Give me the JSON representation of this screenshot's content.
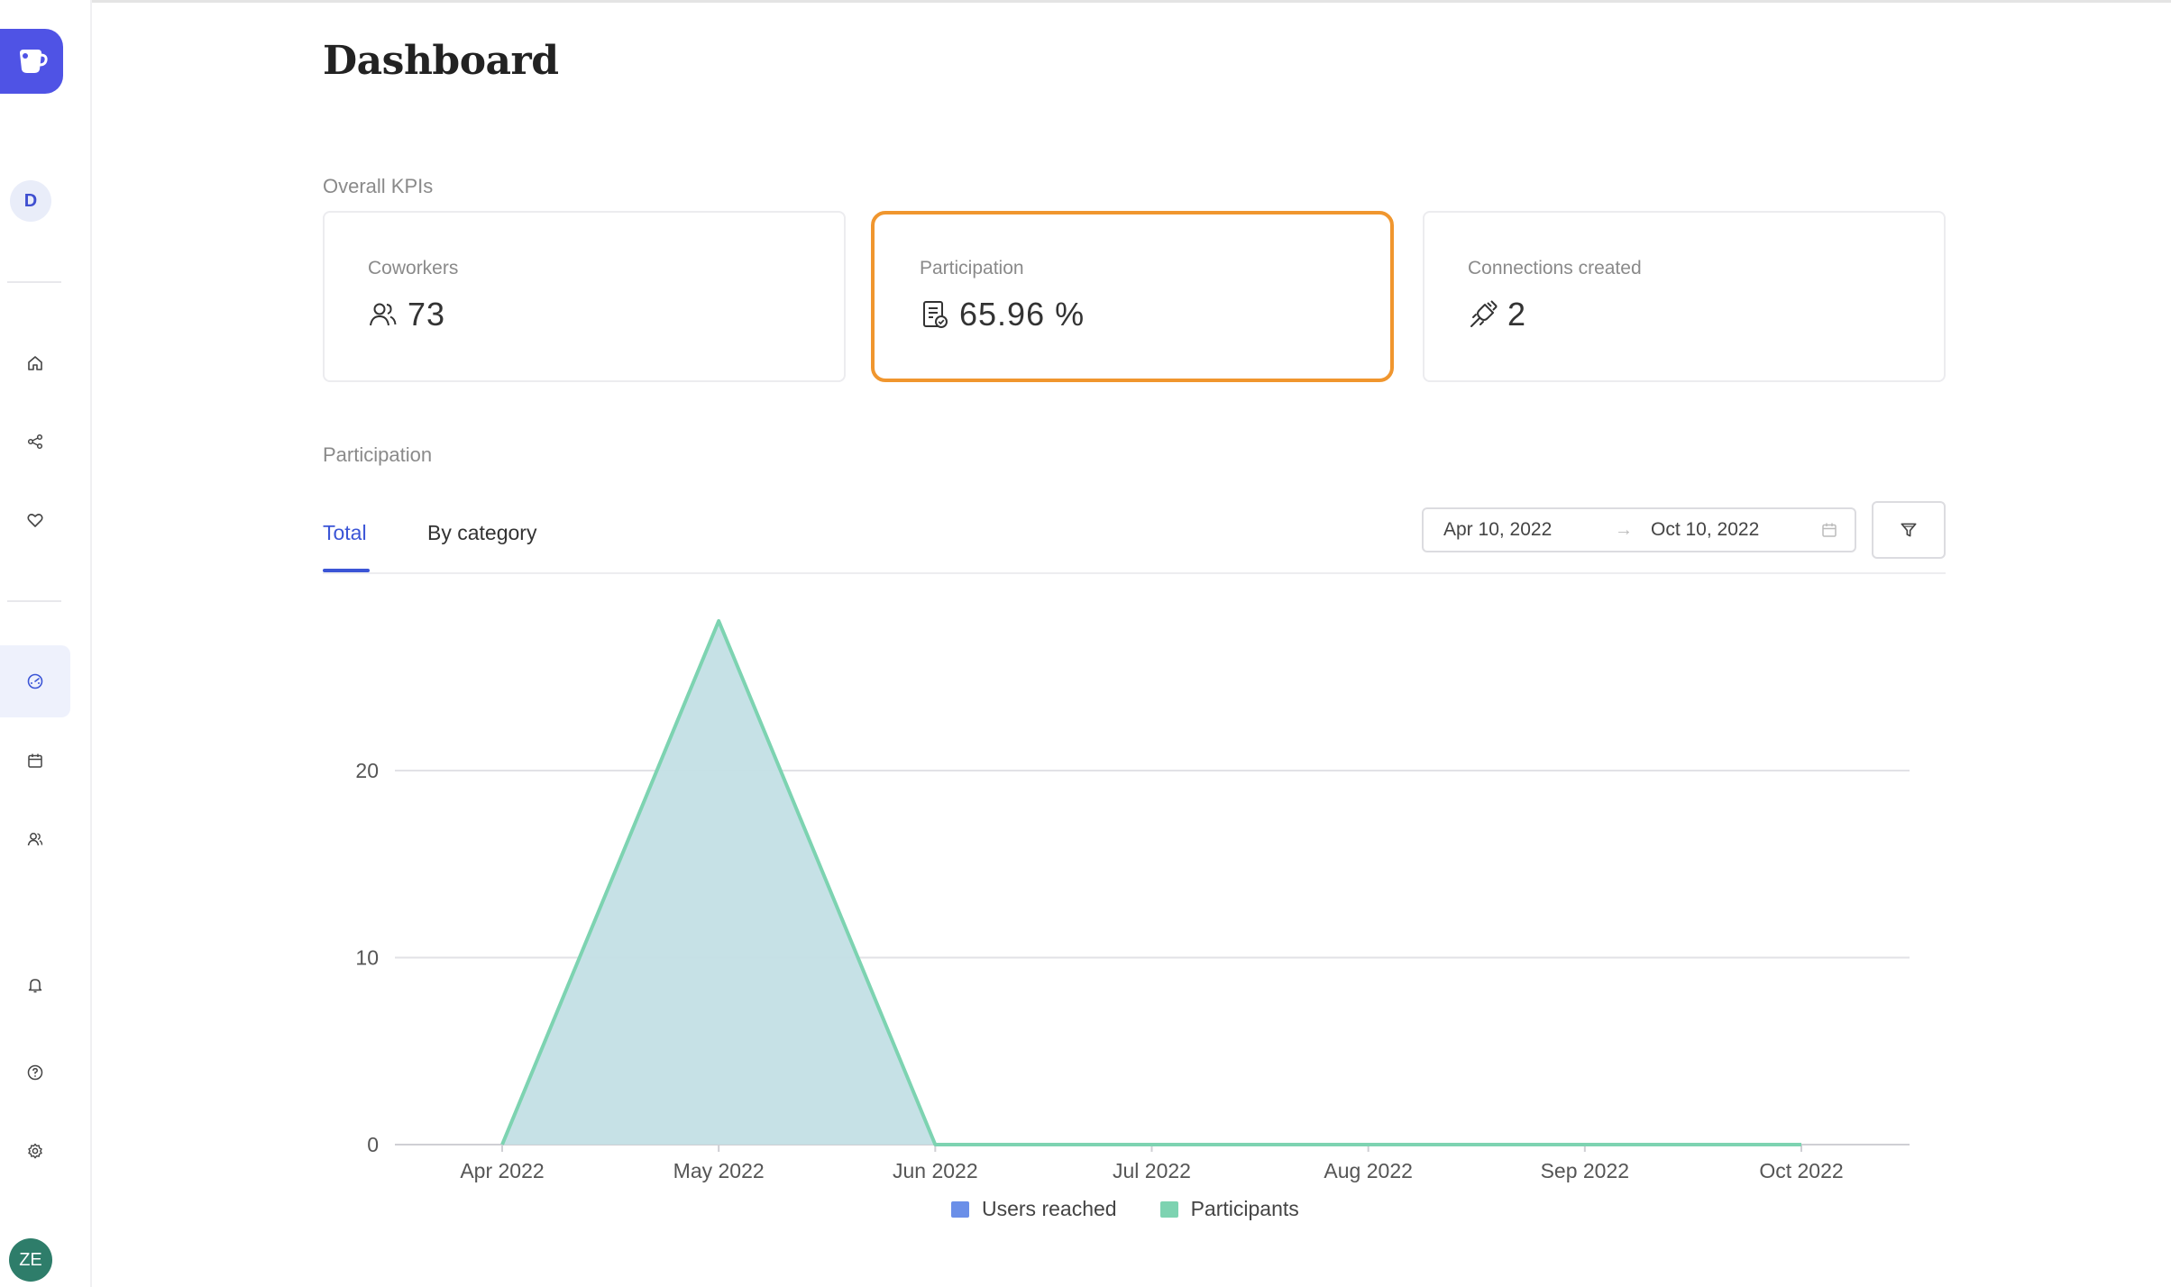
{
  "page": {
    "title": "Dashboard"
  },
  "sidebar": {
    "workspace_initial": "D",
    "user_initials": "ZE",
    "nav": [
      {
        "icon": "home-icon"
      },
      {
        "icon": "share-icon"
      },
      {
        "icon": "heart-icon"
      },
      {
        "icon": "dashboard-gauge-icon",
        "active": true
      },
      {
        "icon": "calendar-icon"
      },
      {
        "icon": "users-icon"
      },
      {
        "icon": "bell-icon"
      },
      {
        "icon": "help-icon"
      },
      {
        "icon": "settings-icon"
      }
    ]
  },
  "kpis": {
    "section_label": "Overall KPIs",
    "cards": [
      {
        "label": "Coworkers",
        "value": "73",
        "icon": "users-icon"
      },
      {
        "label": "Participation",
        "value": "65.96 %",
        "icon": "survey-check-icon",
        "highlighted": true
      },
      {
        "label": "Connections created",
        "value": "2",
        "icon": "plug-connection-icon"
      }
    ]
  },
  "participation": {
    "section_label": "Participation",
    "tabs": [
      "Total",
      "By category"
    ],
    "active_tab": "Total",
    "date_start": "Apr 10, 2022",
    "date_arrow": "→",
    "date_end": "Oct 10, 2022"
  },
  "colors": {
    "accent": "#3b55d6",
    "highlight_border": "#f0962e",
    "users_reached": "#6b8fe8",
    "participants": "#7dd3b1",
    "area_fill": "#c3dfe5"
  },
  "chart_data": {
    "type": "area",
    "categories": [
      "Apr 2022",
      "May 2022",
      "Jun 2022",
      "Jul 2022",
      "Aug 2022",
      "Sep 2022",
      "Oct 2022"
    ],
    "series": [
      {
        "name": "Users reached",
        "values": [
          0,
          28,
          0,
          0,
          0,
          0,
          0
        ],
        "color": "#6b8fe8"
      },
      {
        "name": "Participants",
        "values": [
          0,
          28,
          0,
          0,
          0,
          0,
          0
        ],
        "color": "#7dd3b1"
      }
    ],
    "y_ticks": [
      0,
      10,
      20
    ],
    "ylim": [
      0,
      30
    ],
    "grid": true,
    "legend": "bottom-center"
  }
}
